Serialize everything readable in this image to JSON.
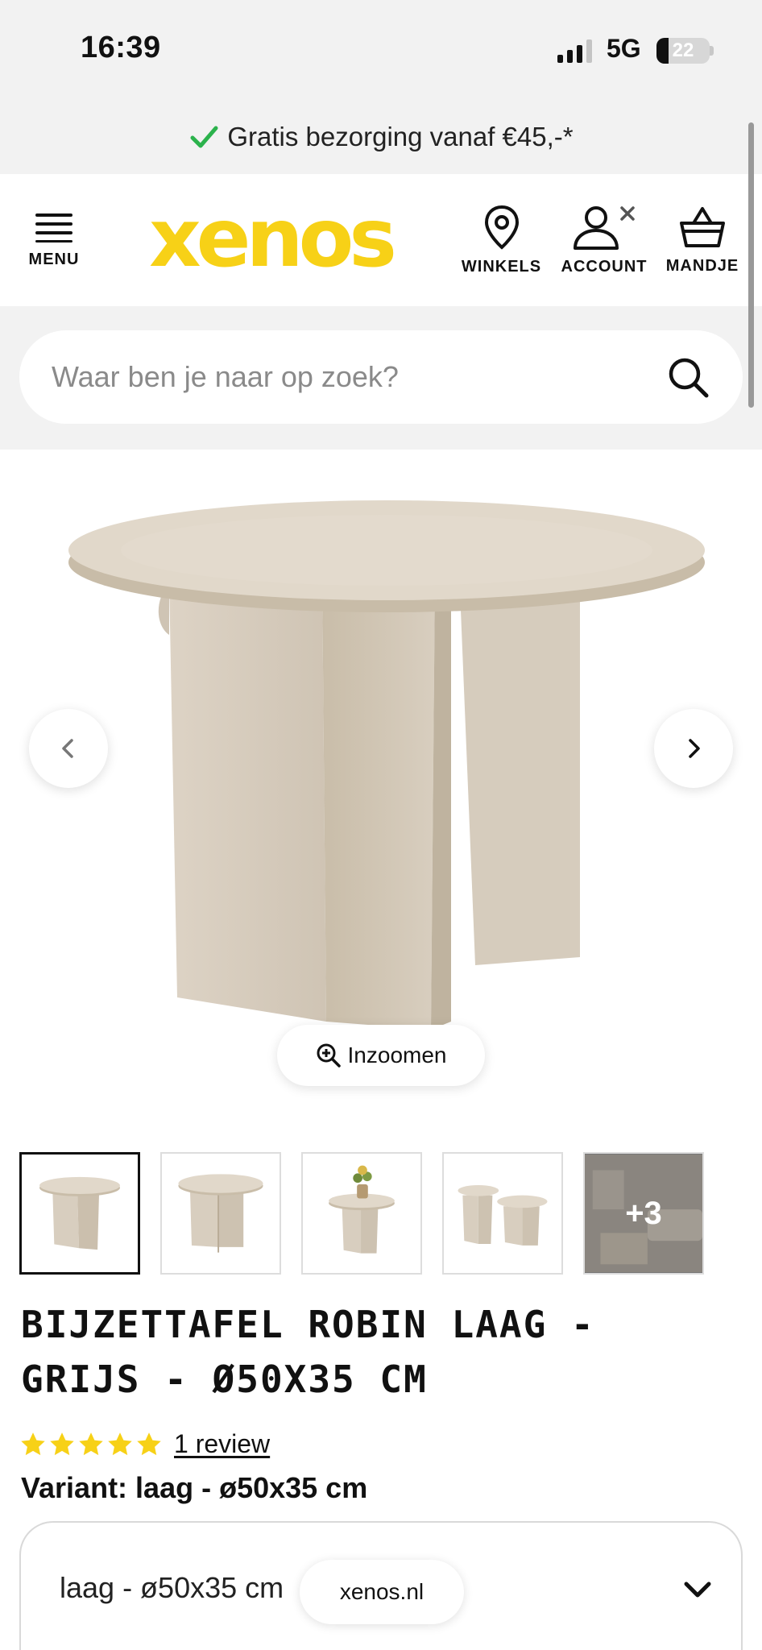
{
  "status_bar": {
    "time": "16:39",
    "network": "5G",
    "battery": "22",
    "battery_level": 0.22
  },
  "promo": {
    "text": "Gratis bezorging vanaf €45,-*",
    "check_color": "#2bb24c"
  },
  "header": {
    "menu_label": "MENU",
    "logo_text": "xenos",
    "logo_color": "#f7d117",
    "stores_label": "WINKELS",
    "account_label": "ACCOUNT",
    "cart_label": "MANDJE"
  },
  "search": {
    "placeholder": "Waar ben je naar op zoek?"
  },
  "gallery": {
    "zoom_label": "Inzoomen",
    "more_count": "+3",
    "thumbnail_count": 5,
    "active_thumbnail": 1
  },
  "product": {
    "title": "BIJZETTAFEL ROBIN LAAG - GRIJS - Ø50X35 CM",
    "rating": 5,
    "review_link": "1 review",
    "variant_label": "Variant: laag - ø50x35 cm",
    "variant_value": "laag - ø50x35 cm"
  },
  "browser": {
    "domain": "xenos.nl"
  },
  "colors": {
    "star": "#f7d117",
    "band": "#f2f2f2"
  }
}
